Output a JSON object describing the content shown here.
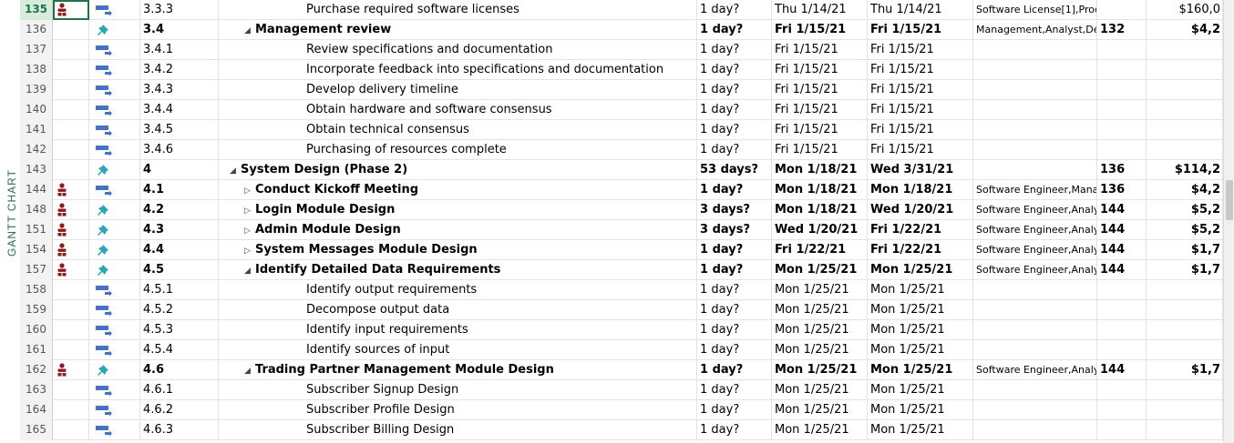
{
  "side_label": "GANTT CHART",
  "colors": {
    "accent": "#217346",
    "resource_icon": "#8b1c1c",
    "mode_icon": "#4472c4",
    "manual_pin": "#2aa6b8"
  },
  "rows": [
    {
      "id": "135",
      "res": true,
      "mode": "auto",
      "wbs": "3.3.3",
      "indent": 2,
      "toggle": "",
      "name": "Purchase required software licenses",
      "dur": "1 day?",
      "start": "Thu 1/14/21",
      "finish": "Thu 1/14/21",
      "resources": "Software License[1],Proc",
      "pred": "",
      "cost": "$160,0",
      "bold": false,
      "selected": true
    },
    {
      "id": "136",
      "res": false,
      "mode": "manual",
      "wbs": "3.4",
      "indent": 1,
      "toggle": "◢",
      "name": "Management review",
      "dur": "1 day?",
      "start": "Fri 1/15/21",
      "finish": "Fri 1/15/21",
      "resources": "Management,Analyst,De",
      "pred": "132",
      "cost": "$4,2",
      "bold": true,
      "selected": false
    },
    {
      "id": "137",
      "res": false,
      "mode": "auto",
      "wbs": "3.4.1",
      "indent": 2,
      "toggle": "",
      "name": "Review specifications and documentation",
      "dur": "1 day?",
      "start": "Fri 1/15/21",
      "finish": "Fri 1/15/21",
      "resources": "",
      "pred": "",
      "cost": "",
      "bold": false,
      "selected": false
    },
    {
      "id": "138",
      "res": false,
      "mode": "auto",
      "wbs": "3.4.2",
      "indent": 2,
      "toggle": "",
      "name": "Incorporate feedback into specifications and documentation",
      "dur": "1 day?",
      "start": "Fri 1/15/21",
      "finish": "Fri 1/15/21",
      "resources": "",
      "pred": "",
      "cost": "",
      "bold": false,
      "selected": false
    },
    {
      "id": "139",
      "res": false,
      "mode": "auto",
      "wbs": "3.4.3",
      "indent": 2,
      "toggle": "",
      "name": "Develop delivery timeline",
      "dur": "1 day?",
      "start": "Fri 1/15/21",
      "finish": "Fri 1/15/21",
      "resources": "",
      "pred": "",
      "cost": "",
      "bold": false,
      "selected": false
    },
    {
      "id": "140",
      "res": false,
      "mode": "auto",
      "wbs": "3.4.4",
      "indent": 2,
      "toggle": "",
      "name": "Obtain hardware and software consensus",
      "dur": "1 day?",
      "start": "Fri 1/15/21",
      "finish": "Fri 1/15/21",
      "resources": "",
      "pred": "",
      "cost": "",
      "bold": false,
      "selected": false
    },
    {
      "id": "141",
      "res": false,
      "mode": "auto",
      "wbs": "3.4.5",
      "indent": 2,
      "toggle": "",
      "name": "Obtain technical consensus",
      "dur": "1 day?",
      "start": "Fri 1/15/21",
      "finish": "Fri 1/15/21",
      "resources": "",
      "pred": "",
      "cost": "",
      "bold": false,
      "selected": false
    },
    {
      "id": "142",
      "res": false,
      "mode": "auto",
      "wbs": "3.4.6",
      "indent": 2,
      "toggle": "",
      "name": "Purchasing of resources complete",
      "dur": "1 day?",
      "start": "Fri 1/15/21",
      "finish": "Fri 1/15/21",
      "resources": "",
      "pred": "",
      "cost": "",
      "bold": false,
      "selected": false
    },
    {
      "id": "143",
      "res": false,
      "mode": "manual",
      "wbs": "4",
      "indent": 0,
      "toggle": "◢",
      "name": "System Design (Phase 2)",
      "dur": "53 days?",
      "start": "Mon 1/18/21",
      "finish": "Wed 3/31/21",
      "resources": "",
      "pred": "136",
      "cost": "$114,2",
      "bold": true,
      "selected": false
    },
    {
      "id": "144",
      "res": true,
      "mode": "auto",
      "wbs": "4.1",
      "indent": 1,
      "toggle": "▷",
      "name": "Conduct Kickoff Meeting",
      "dur": "1 day?",
      "start": "Mon 1/18/21",
      "finish": "Mon 1/18/21",
      "resources": "Software Engineer,Mana",
      "pred": "136",
      "cost": "$4,2",
      "bold": true,
      "selected": false
    },
    {
      "id": "148",
      "res": true,
      "mode": "manual",
      "wbs": "4.2",
      "indent": 1,
      "toggle": "▷",
      "name": "Login Module Design",
      "dur": "3 days?",
      "start": "Mon 1/18/21",
      "finish": "Wed 1/20/21",
      "resources": "Software Engineer,Analy",
      "pred": "144",
      "cost": "$5,2",
      "bold": true,
      "selected": false
    },
    {
      "id": "151",
      "res": true,
      "mode": "manual",
      "wbs": "4.3",
      "indent": 1,
      "toggle": "▷",
      "name": "Admin Module Design",
      "dur": "3 days?",
      "start": "Wed 1/20/21",
      "finish": "Fri 1/22/21",
      "resources": "Software Engineer,Analy",
      "pred": "144",
      "cost": "$5,2",
      "bold": true,
      "selected": false
    },
    {
      "id": "154",
      "res": true,
      "mode": "manual",
      "wbs": "4.4",
      "indent": 1,
      "toggle": "▷",
      "name": "System Messages Module Design",
      "dur": "1 day?",
      "start": "Fri 1/22/21",
      "finish": "Fri 1/22/21",
      "resources": "Software Engineer,Analy",
      "pred": "144",
      "cost": "$1,7",
      "bold": true,
      "selected": false
    },
    {
      "id": "157",
      "res": true,
      "mode": "manual",
      "wbs": "4.5",
      "indent": 1,
      "toggle": "◢",
      "name": "Identify Detailed Data Requirements",
      "dur": "1 day?",
      "start": "Mon 1/25/21",
      "finish": "Mon 1/25/21",
      "resources": "Software Engineer,Analy",
      "pred": "144",
      "cost": "$1,7",
      "bold": true,
      "selected": false
    },
    {
      "id": "158",
      "res": false,
      "mode": "auto",
      "wbs": "4.5.1",
      "indent": 2,
      "toggle": "",
      "name": "Identify output requirements",
      "dur": "1 day?",
      "start": "Mon 1/25/21",
      "finish": "Mon 1/25/21",
      "resources": "",
      "pred": "",
      "cost": "",
      "bold": false,
      "selected": false
    },
    {
      "id": "159",
      "res": false,
      "mode": "auto",
      "wbs": "4.5.2",
      "indent": 2,
      "toggle": "",
      "name": "Decompose output data",
      "dur": "1 day?",
      "start": "Mon 1/25/21",
      "finish": "Mon 1/25/21",
      "resources": "",
      "pred": "",
      "cost": "",
      "bold": false,
      "selected": false
    },
    {
      "id": "160",
      "res": false,
      "mode": "auto",
      "wbs": "4.5.3",
      "indent": 2,
      "toggle": "",
      "name": "Identify input requirements",
      "dur": "1 day?",
      "start": "Mon 1/25/21",
      "finish": "Mon 1/25/21",
      "resources": "",
      "pred": "",
      "cost": "",
      "bold": false,
      "selected": false
    },
    {
      "id": "161",
      "res": false,
      "mode": "auto",
      "wbs": "4.5.4",
      "indent": 2,
      "toggle": "",
      "name": "Identify sources of input",
      "dur": "1 day?",
      "start": "Mon 1/25/21",
      "finish": "Mon 1/25/21",
      "resources": "",
      "pred": "",
      "cost": "",
      "bold": false,
      "selected": false
    },
    {
      "id": "162",
      "res": true,
      "mode": "manual",
      "wbs": "4.6",
      "indent": 1,
      "toggle": "◢",
      "name": "Trading Partner Management Module Design",
      "dur": "1 day?",
      "start": "Mon 1/25/21",
      "finish": "Mon 1/25/21",
      "resources": "Software Engineer,Analy",
      "pred": "144",
      "cost": "$1,7",
      "bold": true,
      "selected": false
    },
    {
      "id": "163",
      "res": false,
      "mode": "auto",
      "wbs": "4.6.1",
      "indent": 2,
      "toggle": "",
      "name": "Subscriber Signup Design",
      "dur": "1 day?",
      "start": "Mon 1/25/21",
      "finish": "Mon 1/25/21",
      "resources": "",
      "pred": "",
      "cost": "",
      "bold": false,
      "selected": false
    },
    {
      "id": "164",
      "res": false,
      "mode": "auto",
      "wbs": "4.6.2",
      "indent": 2,
      "toggle": "",
      "name": "Subscriber Profile Design",
      "dur": "1 day?",
      "start": "Mon 1/25/21",
      "finish": "Mon 1/25/21",
      "resources": "",
      "pred": "",
      "cost": "",
      "bold": false,
      "selected": false
    },
    {
      "id": "165",
      "res": false,
      "mode": "auto",
      "wbs": "4.6.3",
      "indent": 2,
      "toggle": "",
      "name": "Subscriber Billing Design",
      "dur": "1 day?",
      "start": "Mon 1/25/21",
      "finish": "Mon 1/25/21",
      "resources": "",
      "pred": "",
      "cost": "",
      "bold": false,
      "selected": false
    }
  ]
}
